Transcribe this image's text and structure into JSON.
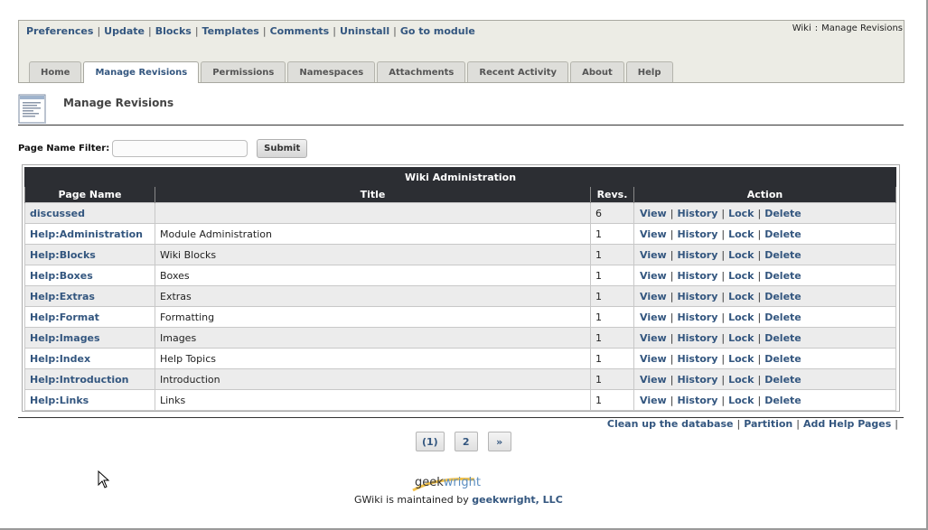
{
  "admin_links": [
    "Preferences",
    "Update",
    "Blocks",
    "Templates",
    "Comments",
    "Uninstall",
    "Go to module"
  ],
  "breadcrumb": {
    "module": "Wiki",
    "separator": ":",
    "page": "Manage Revisions"
  },
  "tabs": [
    {
      "label": "Home",
      "active": false
    },
    {
      "label": "Manage Revisions",
      "active": true
    },
    {
      "label": "Permissions",
      "active": false
    },
    {
      "label": "Namespaces",
      "active": false
    },
    {
      "label": "Attachments",
      "active": false
    },
    {
      "label": "Recent Activity",
      "active": false
    },
    {
      "label": "About",
      "active": false
    },
    {
      "label": "Help",
      "active": false
    }
  ],
  "page_title": "Manage Revisions",
  "filter": {
    "label": "Page Name Filter:",
    "value": "",
    "submit_label": "Submit"
  },
  "table": {
    "caption": "Wiki Administration",
    "columns": [
      "Page Name",
      "Title",
      "Revs.",
      "Action"
    ],
    "actions": [
      "View",
      "History",
      "Lock",
      "Delete"
    ],
    "rows": [
      {
        "page": "discussed",
        "title": "",
        "revs": "6"
      },
      {
        "page": "Help:Administration",
        "title": "Module Administration",
        "revs": "1"
      },
      {
        "page": "Help:Blocks",
        "title": "Wiki Blocks",
        "revs": "1"
      },
      {
        "page": "Help:Boxes",
        "title": "Boxes",
        "revs": "1"
      },
      {
        "page": "Help:Extras",
        "title": "Extras",
        "revs": "1"
      },
      {
        "page": "Help:Format",
        "title": "Formatting",
        "revs": "1"
      },
      {
        "page": "Help:Images",
        "title": "Images",
        "revs": "1"
      },
      {
        "page": "Help:Index",
        "title": "Help Topics",
        "revs": "1"
      },
      {
        "page": "Help:Introduction",
        "title": "Introduction",
        "revs": "1"
      },
      {
        "page": "Help:Links",
        "title": "Links",
        "revs": "1"
      }
    ]
  },
  "footer_links": [
    "Clean up the database",
    "Partition",
    "Add Help Pages"
  ],
  "pager": {
    "pages": [
      "(1)",
      "2"
    ],
    "next": "»"
  },
  "logo": {
    "text_a": "geek",
    "text_b": "wright"
  },
  "maintained": {
    "prefix": "GWiki is maintained by",
    "link": "geekwright, LLC"
  },
  "colors": {
    "link": "#33567f",
    "header_bg": "#2c2e33",
    "admin_bg": "#ecece5",
    "alt_row": "#ececec"
  }
}
